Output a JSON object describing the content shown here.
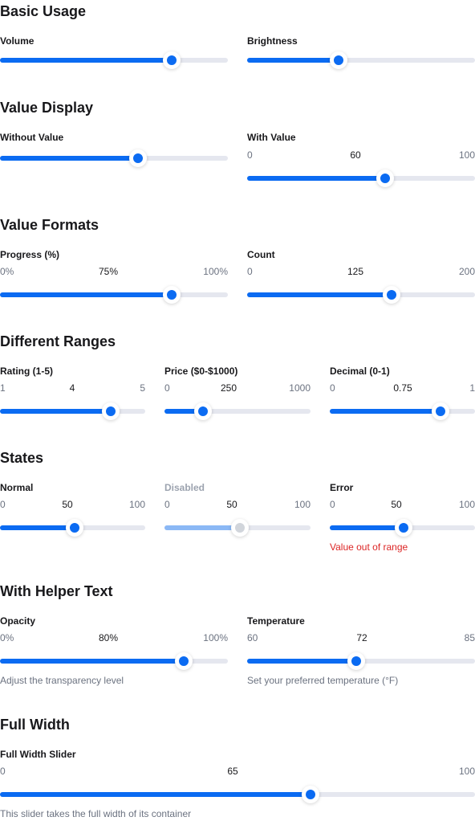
{
  "sections": {
    "basic": "Basic Usage",
    "display": "Value Display",
    "formats": "Value Formats",
    "ranges": "Different Ranges",
    "states": "States",
    "helper": "With Helper Text",
    "full": "Full Width"
  },
  "sliders": {
    "volume": {
      "label": "Volume",
      "value": 75,
      "fraction": 0.755
    },
    "brightness": {
      "label": "Brightness",
      "value": 50,
      "fraction": 0.4
    },
    "without_value": {
      "label": "Without Value",
      "value": 60,
      "fraction": 0.605
    },
    "with_value": {
      "label": "With Value",
      "min": "0",
      "max": "100",
      "current": "60",
      "fraction": 0.607
    },
    "progress": {
      "label": "Progress (%)",
      "min": "0%",
      "max": "100%",
      "current": "75%",
      "fraction": 0.755
    },
    "count": {
      "label": "Count",
      "min": "0",
      "max": "200",
      "current": "125",
      "fraction": 0.635
    },
    "rating": {
      "label": "Rating (1-5)",
      "min": "1",
      "max": "5",
      "current": "4",
      "fraction": 0.765
    },
    "price": {
      "label": "Price ($0-$1000)",
      "min": "0",
      "max": "1000",
      "current": "250",
      "fraction": 0.265
    },
    "decimal": {
      "label": "Decimal (0-1)",
      "min": "0",
      "max": "1",
      "current": "0.75",
      "fraction": 0.765
    },
    "normal": {
      "label": "Normal",
      "min": "0",
      "max": "100",
      "current": "50",
      "fraction": 0.515
    },
    "disabled": {
      "label": "Disabled",
      "min": "0",
      "max": "100",
      "current": "50",
      "fraction": 0.515
    },
    "error": {
      "label": "Error",
      "min": "0",
      "max": "100",
      "current": "50",
      "fraction": 0.506,
      "helper": "Value out of range"
    },
    "opacity": {
      "label": "Opacity",
      "min": "0%",
      "max": "100%",
      "current": "80%",
      "fraction": 0.807,
      "helper": "Adjust the transparency level"
    },
    "temperature": {
      "label": "Temperature",
      "min": "60",
      "max": "85",
      "current": "72",
      "fraction": 0.48,
      "helper": "Set your preferred temperature (°F)"
    },
    "full_width": {
      "label": "Full Width Slider",
      "min": "0",
      "max": "100",
      "current": "65",
      "fraction": 0.654,
      "helper": "This slider takes the full width of its container"
    }
  },
  "colors": {
    "accent": "#0b6bf2",
    "track": "#e5e7ef",
    "error": "#dc2626",
    "disabled_fill": "#8bb8f5"
  }
}
